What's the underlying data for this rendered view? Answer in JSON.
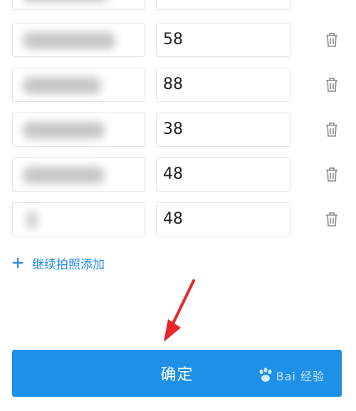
{
  "items": [
    {
      "price": "58"
    },
    {
      "price": "88"
    },
    {
      "price": "38"
    },
    {
      "price": "48"
    },
    {
      "price": "48"
    }
  ],
  "add_more_label": "继续拍照添加",
  "confirm_label": "确定",
  "watermark_text": "Bai  经验",
  "colors": {
    "accent": "#1e88e5",
    "button": "#1e90e8",
    "arrow": "#e8262b"
  }
}
